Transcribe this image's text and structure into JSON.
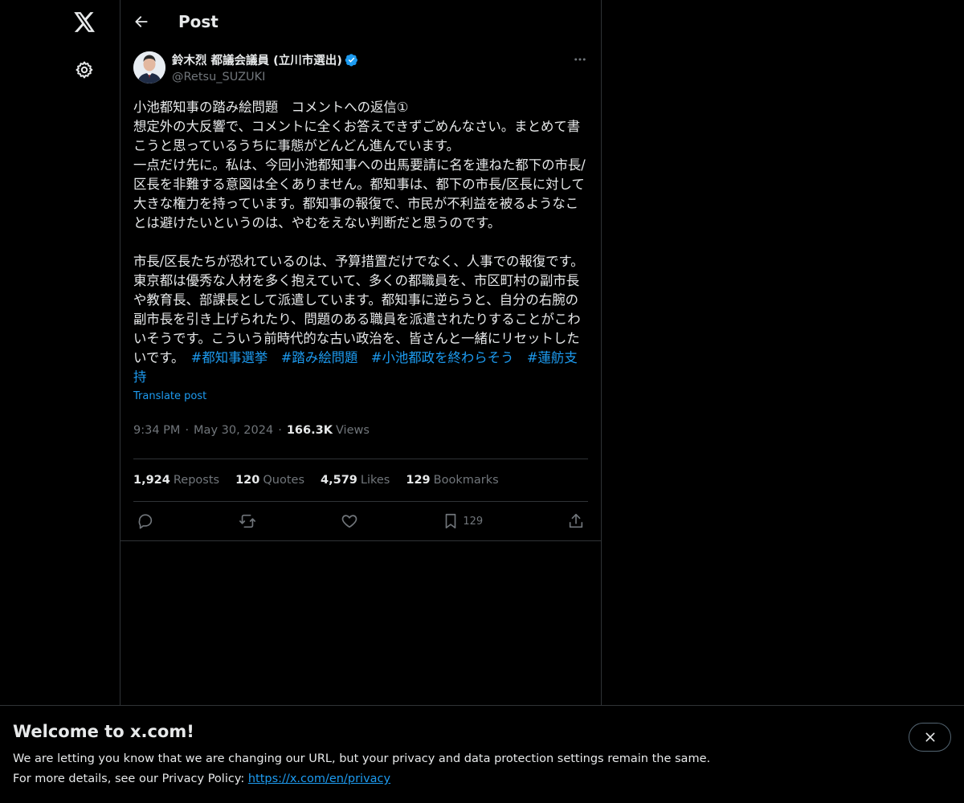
{
  "nav": {
    "logo_icon": "x-logo-icon",
    "settings_icon": "gear-icon"
  },
  "header": {
    "title": "Post"
  },
  "post": {
    "author": {
      "name": "鈴木烈 都議会議員 (立川市選出)",
      "handle": "@Retsu_SUZUKI",
      "verified": true
    },
    "text_main": "小池都知事の踏み絵問題　コメントへの返信①\n想定外の大反響で、コメントに全くお答えできずごめんなさい。まとめて書こうと思っているうちに事態がどんどん進んでいます。\n一点だけ先に。私は、今回小池都知事への出馬要請に名を連ねた都下の市長/区長を非難する意図は全くありません。都知事は、都下の市長/区長に対して大きな権力を持っています。都知事の報復で、市民が不利益を被るようなことは避けたいというのは、やむをえない判断だと思うのです。\n\n市長/区長たちが恐れているのは、予算措置だけでなく、人事での報復です。東京都は優秀な人材を多く抱えていて、多くの都職員を、市区町村の副市長や教育長、部課長として派遣しています。都知事に逆らうと、自分の右腕の副市長を引き上げられたり、問題のある職員を派遣されたりすることがこわいそうです。こういう前時代的な古い政治を、皆さんと一緒にリセットしたいです。　",
    "hashtags": [
      "#都知事選挙",
      "#踏み絵問題",
      "#小池都政を終わらそう",
      "#蓮舫支持"
    ],
    "translate_label": "Translate post",
    "time": "9:34 PM",
    "date": "May 30, 2024",
    "views_count": "166.3K",
    "views_label": "Views",
    "stats": {
      "reposts_count": "1,924",
      "reposts_label": "Reposts",
      "quotes_count": "120",
      "quotes_label": "Quotes",
      "likes_count": "4,579",
      "likes_label": "Likes",
      "bookmarks_count": "129",
      "bookmarks_label": "Bookmarks"
    },
    "actions": {
      "bookmark_count": "129"
    }
  },
  "banner": {
    "title": "Welcome to x.com!",
    "line1": "We are letting you know that we are changing our URL, but your privacy and data protection settings remain the same.",
    "line2_prefix": "For more details, see our Privacy Policy: ",
    "link": "https://x.com/en/privacy"
  },
  "colors": {
    "accent": "#1d9bf0",
    "background": "#000000",
    "text": "#e7e9ea",
    "muted": "#71767b",
    "border": "#2f3336"
  }
}
